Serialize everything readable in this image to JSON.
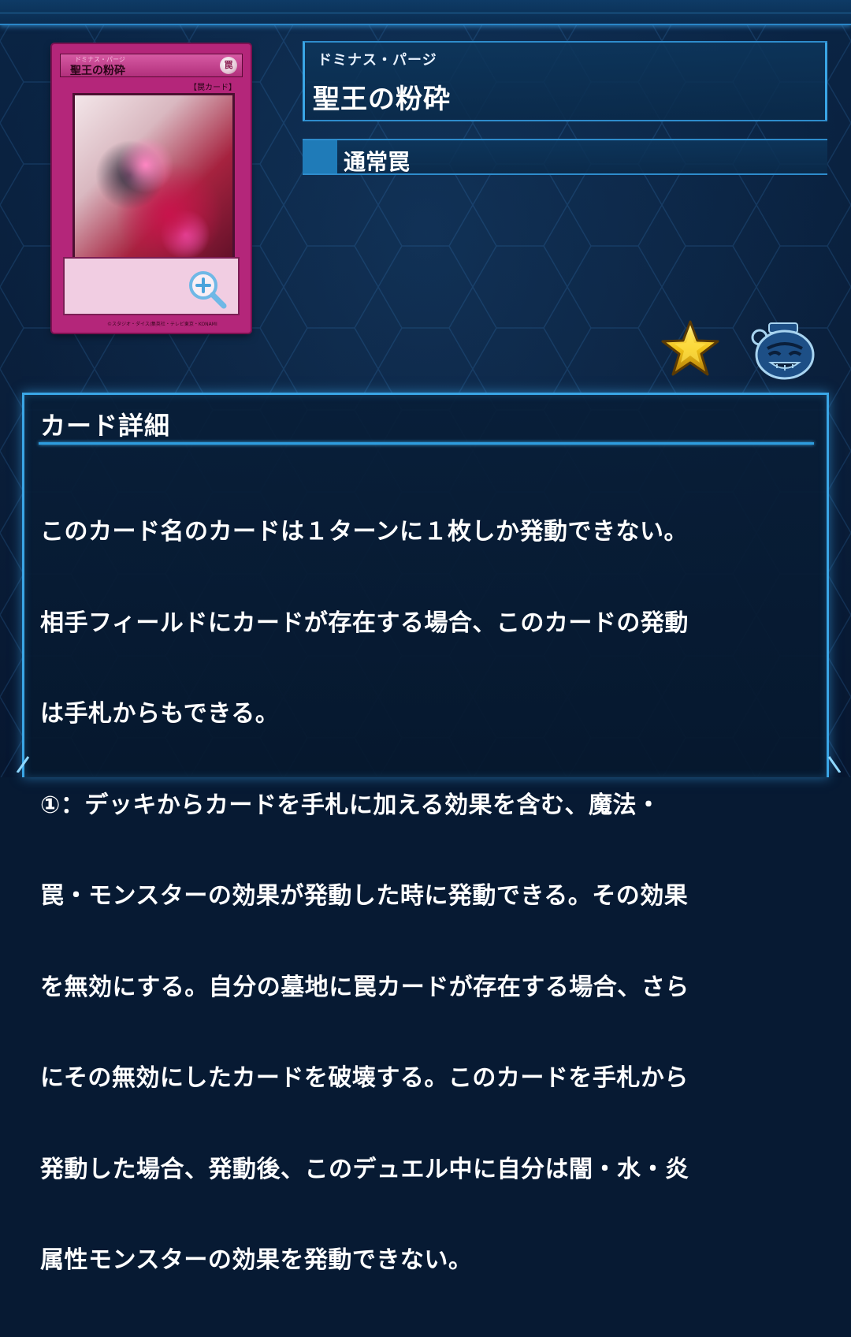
{
  "card_image": {
    "ruby": "ドミナス・パージ",
    "name": "聖王の粉砕",
    "attribute": "罠",
    "type_line": "【罠カード】",
    "copyright": "©スタジオ・ダイス/集英社・テレビ東京・KONAMI"
  },
  "header": {
    "ruby": "ドミナス・パージ",
    "name": "聖王の粉砕",
    "type": "通常罠",
    "type_color": "#1f7bb8"
  },
  "icons": {
    "zoom": "zoom-in-icon",
    "favorite": "star-icon",
    "character": "pot-of-greed-icon"
  },
  "detail": {
    "title": "カード詳細",
    "lines": [
      "このカード名のカードは１ターンに１枚しか発動できない。",
      "相手フィールドにカードが存在する場合、このカードの発動",
      "は手札からもできる。",
      "①：デッキからカードを手札に加える効果を含む、魔法・",
      "罠・モンスターの効果が発動した時に発動できる。その効果",
      "を無効にする。自分の墓地に罠カードが存在する場合、さら",
      "にその無効にしたカードを破壊する。このカードを手札から",
      "発動した場合、発動後、このデュエル中に自分は闇・水・炎",
      "属性モンスターの効果を発動できない。"
    ]
  },
  "colors": {
    "accent": "#3aa6e6",
    "card_frame": "#b4267a",
    "background": "#071a33"
  }
}
